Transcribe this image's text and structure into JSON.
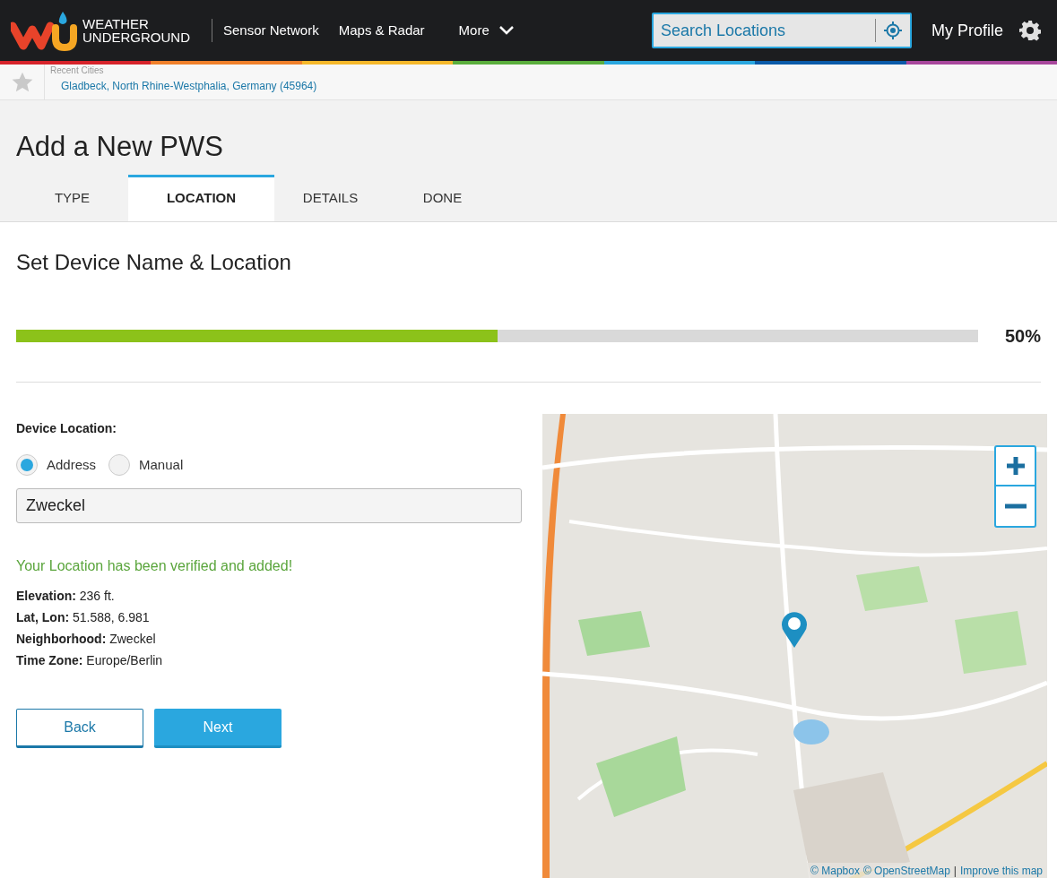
{
  "header": {
    "logo_lines": [
      "WEATHER",
      "UNDERGROUND"
    ],
    "nav": [
      {
        "label": "Sensor Network",
        "kind": "link"
      },
      {
        "label": "Maps & Radar",
        "kind": "link"
      },
      {
        "label": "More",
        "kind": "menu"
      }
    ],
    "search": {
      "placeholder": "Search Locations"
    },
    "profile": "My Profile"
  },
  "recent": {
    "label": "Recent Cities",
    "cities": [
      "Gladbeck, North Rhine-Westphalia, Germany (45964)"
    ]
  },
  "page_title": "Add a New PWS",
  "tabs": [
    {
      "label": "TYPE",
      "selected": false
    },
    {
      "label": "LOCATION",
      "selected": true
    },
    {
      "label": "DETAILS",
      "selected": false
    },
    {
      "label": "DONE",
      "selected": false
    }
  ],
  "section_title": "Set Device Name & Location",
  "progress": {
    "level": 0.5,
    "reading": "50%"
  },
  "location": {
    "label": "Device Location:",
    "options": [
      {
        "label": "Address",
        "selected": true
      },
      {
        "label": "Manual",
        "selected": false
      }
    ],
    "value": "Zweckel",
    "message": "Your Location has been verified and added!",
    "details": [
      {
        "label": "Elevation:",
        "value": "236 ft."
      },
      {
        "label": "Lat, Lon:",
        "value": "51.588, 6.981"
      },
      {
        "label": "Neighborhood:",
        "value": "Zweckel"
      },
      {
        "label": "Time Zone:",
        "value": "Europe/Berlin"
      }
    ]
  },
  "buttons": [
    {
      "label": "Back",
      "kind": "secondary"
    },
    {
      "label": "Next",
      "kind": "primary"
    }
  ],
  "map": {
    "kind": "picture",
    "attribution": [
      "© Mapbox",
      "© OpenStreetMap",
      "|",
      "Improve this map"
    ]
  }
}
